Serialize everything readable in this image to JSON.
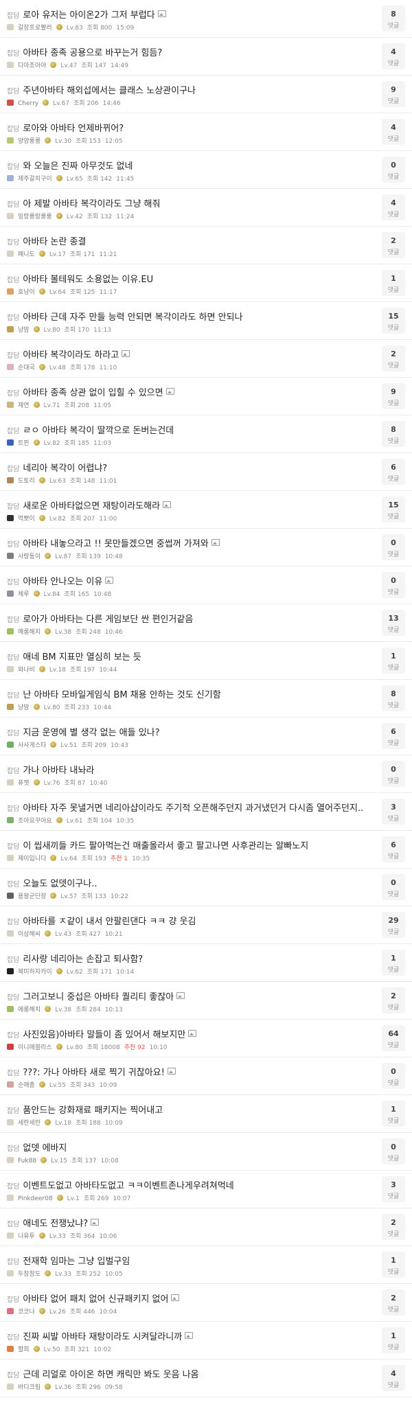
{
  "board": {
    "comment_label": "댓글",
    "posts": [
      {
        "category": "잡담",
        "title": "로아 유저는 아이온2가 그저 부럽다",
        "has_image": true,
        "nick": "갈장프로활러",
        "level": "Lv.83",
        "views": "조회 800",
        "time": "15:09",
        "comments": "8",
        "avatar_color": "#d8d0c0"
      },
      {
        "category": "잡담",
        "title": "아바타 종족 공용으로 바꾸는거 힘듬?",
        "has_image": false,
        "nick": "디아조아아",
        "level": "Lv.47",
        "views": "조회 147",
        "time": "14:49",
        "comments": "4",
        "avatar_color": "#d8d0c0"
      },
      {
        "category": "잡담",
        "title": "주년아바타 해외섭에서는 클래스 노상관이구나",
        "has_image": false,
        "nick": "Cherry",
        "level": "Lv.67",
        "views": "조회 206",
        "time": "14:46",
        "comments": "9",
        "avatar_color": "#d0504a"
      },
      {
        "category": "잡담",
        "title": "로아와 아바타 언제바뀌어?",
        "has_image": false,
        "nick": "양양룽룽",
        "level": "Lv.30",
        "views": "조회 153",
        "time": "12:05",
        "comments": "4",
        "avatar_color": "#b8c870"
      },
      {
        "category": "잡담",
        "title": "와 오늘은 진짜 아무것도 없네",
        "has_image": false,
        "nick": "제주갈치구이",
        "level": "Lv.65",
        "views": "조회 142",
        "time": "11:45",
        "comments": "0",
        "avatar_color": "#a0b0d8"
      },
      {
        "category": "잡담",
        "title": "아 제발 아바타 복각이라도 그냥 해줘",
        "has_image": false,
        "nick": "밍랑룽랑룽룽",
        "level": "Lv.42",
        "views": "조회 132",
        "time": "11:24",
        "comments": "4",
        "avatar_color": "#d8d0c0"
      },
      {
        "category": "잡담",
        "title": "아바타 논란 종결",
        "has_image": false,
        "nick": "페니도",
        "level": "Lv.17",
        "views": "조회 171",
        "time": "11:21",
        "comments": "2",
        "avatar_color": "#d8d0c0"
      },
      {
        "category": "잡담",
        "title": "아바타 볼테워도 소용없는 이유.EU",
        "has_image": false,
        "nick": "호냥이",
        "level": "Lv.64",
        "views": "조회 125",
        "time": "11:17",
        "comments": "1",
        "avatar_color": "#e0a060"
      },
      {
        "category": "잡담",
        "title": "아바타 근데 자주 만들 능력 안되면 복각이라도 하면 안되나",
        "has_image": false,
        "nick": "냥맘",
        "level": "Lv.80",
        "views": "조회 170",
        "time": "11:13",
        "comments": "15",
        "avatar_color": "#c0a050"
      },
      {
        "category": "잡담",
        "title": "아바타 복각이라도 하라고",
        "has_image": true,
        "nick": "순대국",
        "level": "Lv.48",
        "views": "조회 178",
        "time": "11:10",
        "comments": "2",
        "avatar_color": "#e0b0b8"
      },
      {
        "category": "잡담",
        "title": "아바타 종족 상관 없이 입힐 수 있으면",
        "has_image": true,
        "nick": "제연",
        "level": "Lv.71",
        "views": "조회 208",
        "time": "11:05",
        "comments": "9",
        "avatar_color": "#c8b878"
      },
      {
        "category": "잡담",
        "title": "ㄹㅇ 아바타 복각이 딸깍으로 돈버는건데",
        "has_image": false,
        "nick": "트핀",
        "level": "Lv.82",
        "views": "조회 185",
        "time": "11:03",
        "comments": "8",
        "avatar_color": "#3a60c0"
      },
      {
        "category": "잡담",
        "title": "네리아 복각이 어렵냐?",
        "has_image": false,
        "nick": "도토리",
        "level": "Lv.63",
        "views": "조회 148",
        "time": "11:01",
        "comments": "6",
        "avatar_color": "#b08850"
      },
      {
        "category": "잡담",
        "title": "새로운 아바타없으면 재탕이라도해라",
        "has_image": true,
        "nick": "먹뽀이",
        "level": "Lv.82",
        "views": "조회 207",
        "time": "11:00",
        "comments": "15",
        "avatar_color": "#303030"
      },
      {
        "category": "잡담",
        "title": "아바타 내놓으라고 !! 못만들겠으면 중썹꺼 가져와",
        "has_image": true,
        "nick": "사랑동이",
        "level": "Lv.87",
        "views": "조회 139",
        "time": "10:48",
        "comments": "0",
        "avatar_color": "#808080"
      },
      {
        "category": "잡담",
        "title": "아바타 안나오는 이유",
        "has_image": true,
        "nick": "체루",
        "level": "Lv.84",
        "views": "조회 165",
        "time": "10:48",
        "comments": "0",
        "avatar_color": "#9090a0"
      },
      {
        "category": "잡담",
        "title": "로아가 아바타는 다른 게임보단 싼 편인거같음",
        "has_image": false,
        "nick": "메롱해치",
        "level": "Lv.38",
        "views": "조회 248",
        "time": "10:46",
        "comments": "13",
        "avatar_color": "#a0c060"
      },
      {
        "category": "잡담",
        "title": "애네 BM 지표만 열심히 보는 듯",
        "has_image": false,
        "nick": "와나비",
        "level": "Lv.18",
        "views": "조회 197",
        "time": "10:44",
        "comments": "1",
        "avatar_color": "#d8d0c0"
      },
      {
        "category": "잡담",
        "title": "난 아바타 모바일게임식 BM 채용 안하는 것도 신기함",
        "has_image": false,
        "nick": "냥맘",
        "level": "Lv.80",
        "views": "조회 233",
        "time": "10:44",
        "comments": "8",
        "avatar_color": "#c0a050"
      },
      {
        "category": "잡담",
        "title": "지금 운영에 별 생각 없는 애들 있나?",
        "has_image": false,
        "nick": "사사게스타",
        "level": "Lv.51",
        "views": "조회 209",
        "time": "10:43",
        "comments": "6",
        "avatar_color": "#70b060"
      },
      {
        "category": "잡담",
        "title": "가나 아바타 내놔라",
        "has_image": false,
        "nick": "퓨젯",
        "level": "Lv.76",
        "views": "조회 87",
        "time": "10:40",
        "comments": "0",
        "avatar_color": "#d8d0c0"
      },
      {
        "category": "잡담",
        "title": "아바타 자주 못낼거면 네리아샵이라도 주기적 오픈해주던지 과거냈던거 다시좀 열어주던지..",
        "has_image": false,
        "nick": "조아요꾸아요",
        "level": "Lv.61",
        "views": "조회 104",
        "time": "10:35",
        "comments": "3",
        "avatar_color": "#80b070"
      },
      {
        "category": "잡담",
        "title": "이 씹새끼들 카드 팔아먹는건 매출올라서 좋고 팔고나면 사후관리는 알빠노지",
        "has_image": false,
        "nick": "제이입니다",
        "level": "Lv.64",
        "views": "조회 193",
        "time": "10:35",
        "comments": "6",
        "avatar_color": "#d8d0c0",
        "recommend": "추천 1"
      },
      {
        "category": "잡담",
        "title": "오늘도 없뎃이구나..",
        "has_image": false,
        "nick": "용왕군단장",
        "level": "Lv.57",
        "views": "조회 133",
        "time": "10:22",
        "comments": "0",
        "avatar_color": "#606060"
      },
      {
        "category": "잡담",
        "title": "아바타를 ㅈ같이 내서 안팔린댄다 ㅋㅋ 걍 웃김",
        "has_image": false,
        "nick": "이상해씨",
        "level": "Lv.43",
        "views": "조회 427",
        "time": "10:21",
        "comments": "29",
        "avatar_color": "#d8d0c0"
      },
      {
        "category": "잡담",
        "title": "리사랑 네리아는 손잡고 퇴사함?",
        "has_image": false,
        "nick": "북미하자카이",
        "level": "Lv.62",
        "views": "조회 171",
        "time": "10:14",
        "comments": "1",
        "avatar_color": "#202020"
      },
      {
        "category": "잡담",
        "title": "그러고보니 중섭은 아바타 퀄리티 좋잖아",
        "has_image": true,
        "nick": "메롱해치",
        "level": "Lv.38",
        "views": "조회 284",
        "time": "10:13",
        "comments": "2",
        "avatar_color": "#a0c060"
      },
      {
        "category": "잡담",
        "title": "사진있음)아바타 말들이 좀 있어서 해보지만",
        "has_image": true,
        "nick": "이니에블리스",
        "level": "Lv.80",
        "views": "조회 18008",
        "time": "10:10",
        "comments": "64",
        "avatar_color": "#d04040",
        "recommend": "추천 92"
      },
      {
        "category": "잡담",
        "title": "???: 가나 아바타 새로 찍기 귀찮아요!",
        "has_image": true,
        "nick": "순애충",
        "level": "Lv.55",
        "views": "조회 343",
        "time": "10:09",
        "comments": "0",
        "avatar_color": "#c8a8a0"
      },
      {
        "category": "잡담",
        "title": "품안드는 강화재료 패키지는 찍어내고",
        "has_image": false,
        "nick": "세란세란",
        "level": "Lv.18",
        "views": "조회 188",
        "time": "10:09",
        "comments": "1",
        "avatar_color": "#d8d0c0"
      },
      {
        "category": "잡담",
        "title": "없뎃 에바지",
        "has_image": false,
        "nick": "Fuk88",
        "level": "Lv.15",
        "views": "조회 137",
        "time": "10:08",
        "comments": "0",
        "avatar_color": "#d8d0c0"
      },
      {
        "category": "잡담",
        "title": "이벤트도없고 아바타도없고 ㅋㅋ이벤트존나게우려쳐먹네",
        "has_image": false,
        "nick": "Pinkdeer08",
        "level": "Lv.1",
        "views": "조회 269",
        "time": "10:07",
        "comments": "3",
        "avatar_color": "#d8d0c0"
      },
      {
        "category": "잡담",
        "title": "애네도 전쟁났냐?",
        "has_image": true,
        "nick": "나유투",
        "level": "Lv.33",
        "views": "조회 364",
        "time": "10:06",
        "comments": "2",
        "avatar_color": "#d8d0c0"
      },
      {
        "category": "잡담",
        "title": "전재학 임마는 그냥 입벌구임",
        "has_image": false,
        "nick": "두장정도",
        "level": "Lv.33",
        "views": "조회 252",
        "time": "10:05",
        "comments": "1",
        "avatar_color": "#d8d0c0"
      },
      {
        "category": "잡담",
        "title": "아바타 없어 패치 없어 신규패키지 없어",
        "has_image": true,
        "nick": "코코나",
        "level": "Lv.26",
        "views": "조회 446",
        "time": "10:04",
        "comments": "2",
        "avatar_color": "#e07080"
      },
      {
        "category": "잡담",
        "title": "진짜 씨발 아바타 재탕이라도 시켜달라니까",
        "has_image": true,
        "nick": "할희",
        "level": "Lv.50",
        "views": "조회 321",
        "time": "10:02",
        "comments": "1",
        "avatar_color": "#e08040"
      },
      {
        "category": "잡담",
        "title": "근데 리얼로 아이온 하면 캐릭만 봐도 웃음 나옴",
        "has_image": false,
        "nick": "바디크림",
        "level": "Lv.36",
        "views": "조회 296",
        "time": "09:58",
        "comments": "4",
        "avatar_color": "#d8d0c0"
      }
    ]
  }
}
